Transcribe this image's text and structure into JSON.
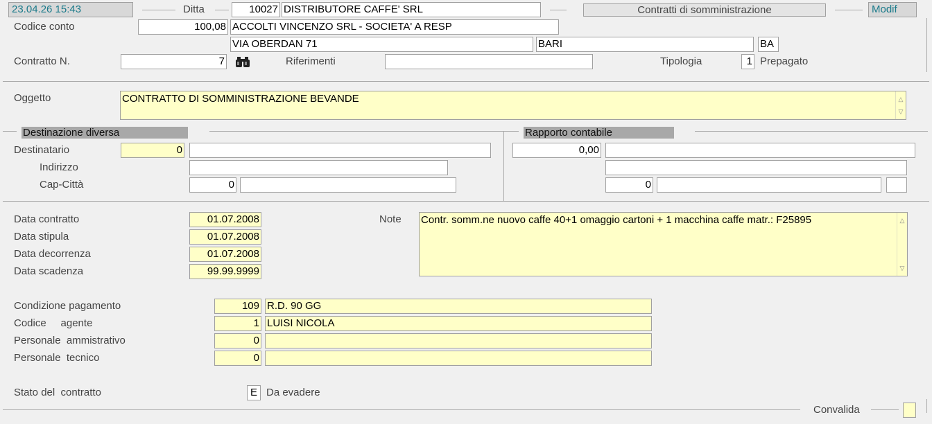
{
  "header": {
    "datetime": "23.04.26 15:43",
    "ditta_label": "Ditta",
    "ditta_code": "10027",
    "ditta_name": "DISTRIBUTORE CAFFE' SRL",
    "title": "Contratti di somministrazione",
    "mode": "Modif"
  },
  "account": {
    "label": "Codice conto",
    "code": "100,08",
    "name": "ACCOLTI VINCENZO SRL - SOCIETA' A RESP",
    "address": "VIA OBERDAN 71",
    "city": "BARI",
    "province": "BA"
  },
  "contract": {
    "number_label": "Contratto N.",
    "number": "7",
    "riferimenti_label": "Riferimenti",
    "riferimenti": "",
    "tipologia_label": "Tipologia",
    "tipologia": "1",
    "tipologia_desc": "Prepagato"
  },
  "oggetto": {
    "label": "Oggetto",
    "value": "CONTRATTO DI SOMMINISTRAZIONE BEVANDE"
  },
  "destinazione": {
    "header": "Destinazione diversa",
    "destinatario_label": "Destinatario",
    "destinatario_code": "0",
    "destinatario_name": "",
    "indirizzo_label": "Indirizzo",
    "indirizzo": "",
    "capcitta_label": "Cap-Città",
    "cap": "0",
    "citta": ""
  },
  "rapporto": {
    "header": "Rapporto contabile",
    "amount": "0,00",
    "desc": "",
    "line2": "",
    "cap": "0",
    "city": "",
    "prov": ""
  },
  "dates": {
    "contratto_label": "Data contratto",
    "contratto": "01.07.2008",
    "stipula_label": "Data stipula",
    "stipula": "01.07.2008",
    "decorrenza_label": "Data decorrenza",
    "decorrenza": "01.07.2008",
    "scadenza_label": "Data scadenza",
    "scadenza": "99.99.9999"
  },
  "note": {
    "label": "Note",
    "value": "Contr. somm.ne nuovo caffe 40+1 omaggio cartoni + 1 macchina caffe matr.: F25895"
  },
  "payment": {
    "condizione_label": "Condizione pagamento",
    "condizione_code": "109",
    "condizione_desc": "R.D. 90 GG",
    "agente_label": "Codice     agente",
    "agente_code": "1",
    "agente_desc": "LUISI NICOLA",
    "amm_label": "Personale  ammistrativo",
    "amm_code": "0",
    "amm_desc": "",
    "tecnico_label": "Personale  tecnico",
    "tecnico_code": "0",
    "tecnico_desc": ""
  },
  "stato": {
    "label": "Stato del  contratto",
    "code": "E",
    "desc": "Da evadere"
  },
  "convalida": {
    "label": "Convalida",
    "value": ""
  },
  "icons": {
    "search": "binoculars-icon"
  }
}
